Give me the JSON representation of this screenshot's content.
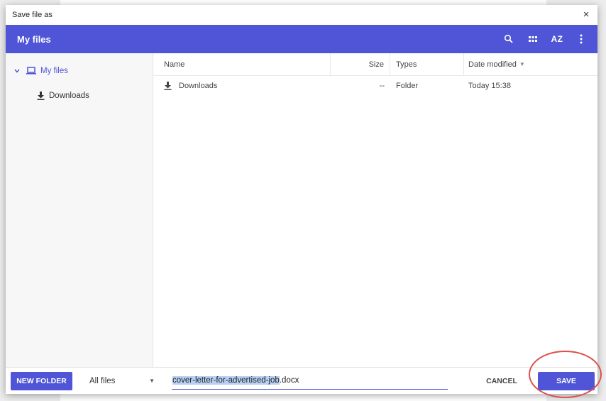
{
  "dialog": {
    "title": "Save file as",
    "close_label": "×"
  },
  "header": {
    "title": "My files",
    "tools": {
      "search_icon": "search-icon",
      "grid_icon": "grid-view-icon",
      "sort_label": "AZ",
      "more_icon": "more-vertical-icon"
    }
  },
  "sidebar": {
    "root": {
      "label": "My files",
      "icon": "laptop-icon",
      "expanded_icon": "chevron-down-icon"
    },
    "children": [
      {
        "label": "Downloads",
        "icon": "download-icon"
      }
    ]
  },
  "table": {
    "columns": {
      "name": "Name",
      "size": "Size",
      "types": "Types",
      "date": "Date modified"
    },
    "rows": [
      {
        "name": "Downloads",
        "size": "--",
        "type": "Folder",
        "date": "Today 15:38"
      }
    ]
  },
  "footer": {
    "new_folder_label": "NEW FOLDER",
    "filter_value": "All files",
    "filename_selected": "cover-letter-for-advertised-job",
    "filename_ext": ".docx",
    "cancel_label": "CANCEL",
    "save_label": "SAVE"
  },
  "colors": {
    "accent": "#4f55d6",
    "annotation": "#d9534f"
  }
}
